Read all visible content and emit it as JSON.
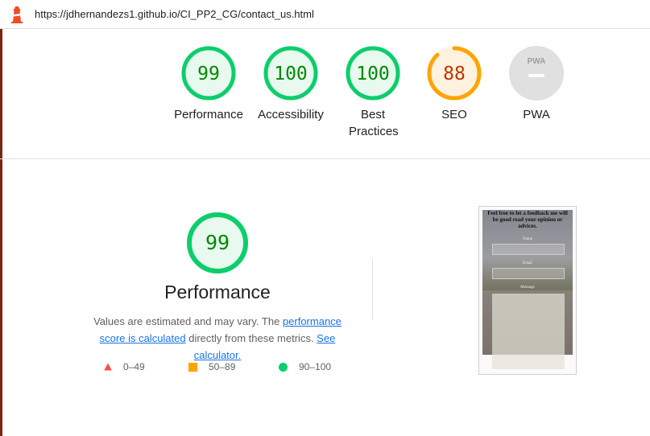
{
  "address_bar": {
    "url": "https://jdhernandezs1.github.io/CI_PP2_CG/contact_us.html",
    "logo_icon": "lighthouse-icon"
  },
  "colors": {
    "pass": "#0cce6b",
    "average": "#ffa400",
    "fail": "#ff4e42",
    "pass_text": "#008800",
    "average_text": "#c33300",
    "na": "#e0e0e0"
  },
  "gauges": [
    {
      "label": "Performance",
      "score": "99",
      "value": 99
    },
    {
      "label": "Accessibility",
      "score": "100",
      "value": 100
    },
    {
      "label": "Best Practices",
      "score": "100",
      "value": 100
    },
    {
      "label": "SEO",
      "score": "88",
      "value": 88
    },
    {
      "label": "PWA",
      "score": "PWA",
      "value": null
    }
  ],
  "performance": {
    "score": "99",
    "value": 99,
    "title": "Performance",
    "desc_pre": "Values are estimated and may vary. The ",
    "desc_link1": "performance score is calculated",
    "desc_mid": " directly from these metrics. ",
    "desc_link2": "See calculator."
  },
  "legend": [
    {
      "range": "0–49",
      "icon": "red-triangle-icon"
    },
    {
      "range": "50–89",
      "icon": "orange-square-icon"
    },
    {
      "range": "90–100",
      "icon": "green-circle-icon"
    }
  ],
  "screenshot": {
    "heading": "Feel free to let a feedback me will be good read your opinion or advices.",
    "field_name": "Name",
    "field_email": "Email",
    "field_message": "Message"
  }
}
